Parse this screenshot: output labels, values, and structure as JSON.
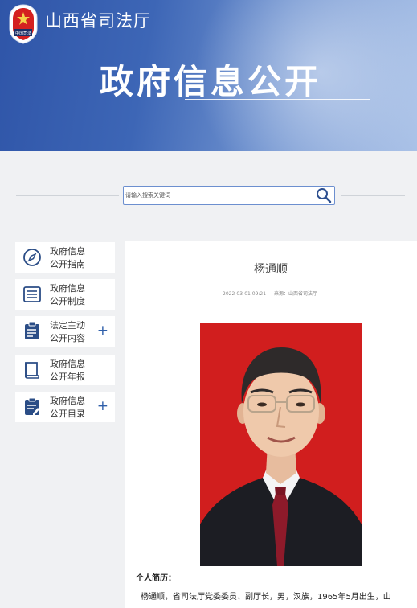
{
  "header": {
    "site_name": "山西省司法厅",
    "emblem_text": "中国司法",
    "page_title": "政府信息公开"
  },
  "search": {
    "placeholder": "请输入搜索关键词",
    "button_icon": "search-icon"
  },
  "sidebar": {
    "items": [
      {
        "line1": "政府信息",
        "line2": "公开指南",
        "icon": "compass-icon",
        "expandable": false
      },
      {
        "line1": "政府信息",
        "line2": "公开制度",
        "icon": "list-document-icon",
        "expandable": false
      },
      {
        "line1": "法定主动",
        "line2": "公开内容",
        "icon": "clipboard-icon",
        "expandable": true
      },
      {
        "line1": "政府信息",
        "line2": "公开年报",
        "icon": "book-icon",
        "expandable": false
      },
      {
        "line1": "政府信息",
        "line2": "公开目录",
        "icon": "clipboard-edit-icon",
        "expandable": true
      }
    ],
    "expand_symbol": "+"
  },
  "article": {
    "title": "杨通顺",
    "date": "2022-03-01 09:21",
    "source": "来源：山西省司法厅",
    "bio_heading": "个人简历：",
    "bio_text": "杨通顺，省司法厅党委委员、副厅长，男，汉族，1965年5月出生，山"
  },
  "colors": {
    "banner": "#3d66b6",
    "accent": "#2f5faa",
    "photo_background": "#d11e1e"
  }
}
